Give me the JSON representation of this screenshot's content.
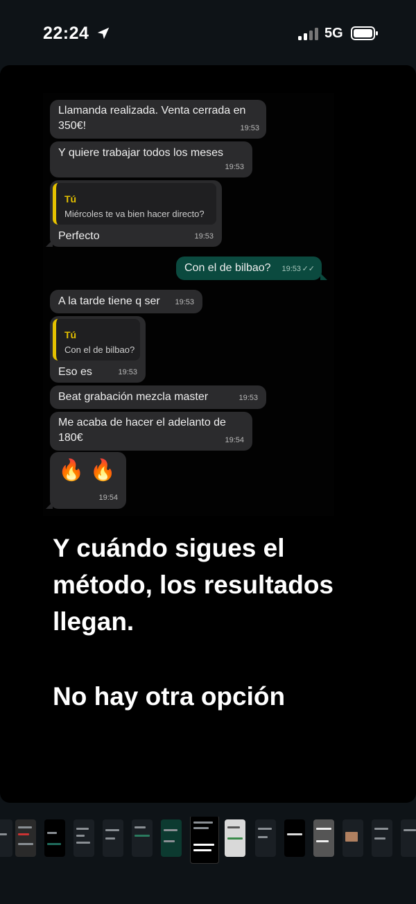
{
  "status_bar": {
    "time": "22:24",
    "network": "5G",
    "icons": [
      "location-arrow-icon",
      "signal-bars-icon",
      "battery-icon"
    ]
  },
  "chat": {
    "messages": [
      {
        "dir": "in",
        "lines": [
          "Llamanda realizada. Venta cerrada en",
          "350€!"
        ],
        "time": "19:53"
      },
      {
        "dir": "in",
        "lines": [
          "Y quiere trabajar todos los meses"
        ],
        "time": "19:53"
      },
      {
        "dir": "in",
        "quote_author": "Tú",
        "quote_text": "Miércoles te va bien hacer directo?",
        "lines": [
          "Perfecto"
        ],
        "time": "19:53"
      },
      {
        "dir": "out",
        "lines": [
          "Con el de bilbao?"
        ],
        "time": "19:53",
        "ticks": "✓✓"
      },
      {
        "dir": "in",
        "lines": [
          "A la tarde tiene q ser"
        ],
        "time": "19:53"
      },
      {
        "dir": "in",
        "quote_author": "Tú",
        "quote_text": "Con el de bilbao?",
        "lines": [
          "Eso es"
        ],
        "time": "19:53"
      },
      {
        "dir": "in",
        "lines": [
          "Beat grabación mezcla master"
        ],
        "time": "19:53"
      },
      {
        "dir": "in",
        "lines": [
          "Me acaba de hacer el adelanto de",
          "180€"
        ],
        "time": "19:54"
      },
      {
        "dir": "in",
        "emoji": "🔥 🔥",
        "time": "19:54"
      }
    ]
  },
  "caption": {
    "line1": "Y cuándo sigues el",
    "line2": "método, los resultados",
    "line3": "llegan.",
    "line4": "No hay otra opción"
  },
  "colors": {
    "background": "#0e1317",
    "bubble_in": "#2b2b2d",
    "bubble_out": "#0b4a3f",
    "quote_accent": "#e5c100"
  }
}
